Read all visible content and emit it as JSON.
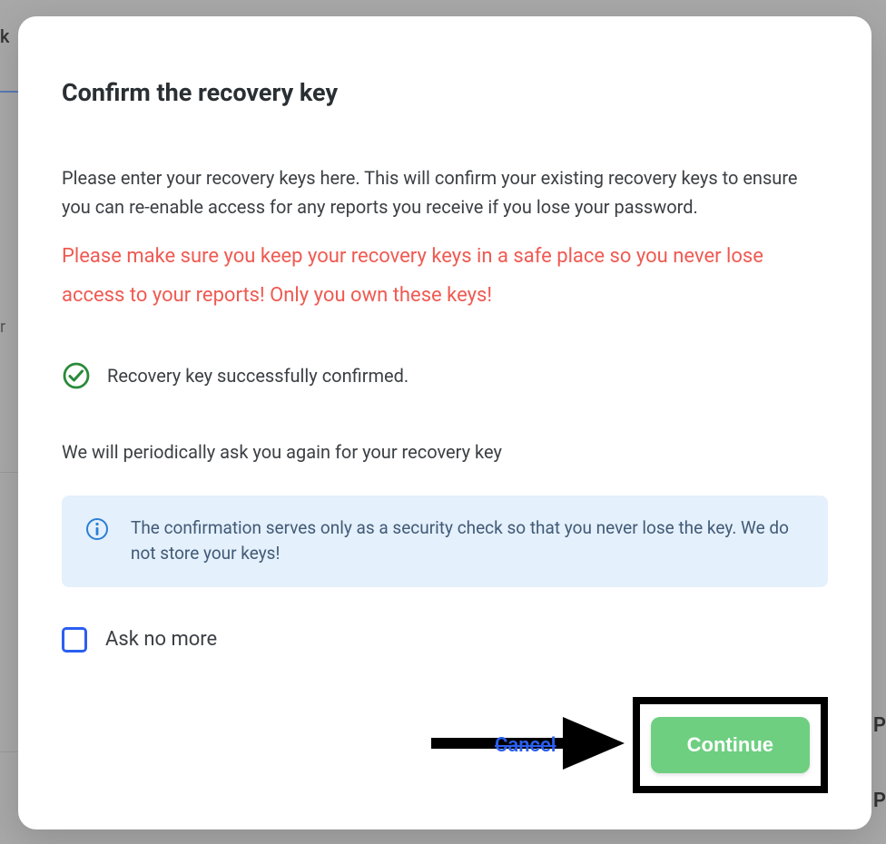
{
  "modal": {
    "title": "Confirm the recovery key",
    "intro": "Please enter your recovery keys here. This will confirm your existing recovery keys to ensure you can re-enable access for any reports you receive if you lose your password.",
    "warning": "Please make sure you keep your recovery keys in a safe place so you never lose access to your reports! Only you own these keys!",
    "success_msg": "Recovery key successfully confirmed.",
    "periodic_msg": "We will periodically ask you again for your recovery key",
    "info_msg": "The confirmation serves only as a security check so that you never lose the key. We do not store your keys!",
    "ask_no_more_label": "Ask no more",
    "cancel_label": "Cancel",
    "continue_label": "Continue"
  },
  "background": {
    "frag_k": "k",
    "frag_r": "r",
    "frag_p": "P"
  }
}
